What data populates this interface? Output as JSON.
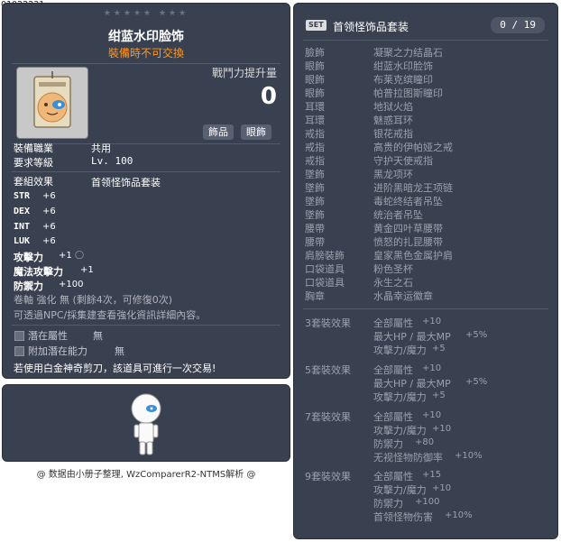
{
  "item_id": "01022231",
  "stars": "★★★★★ ★★★",
  "item": {
    "name": "绀蓝水印脸饰",
    "trade_note": "裝備時不可交換",
    "power_label": "戰鬥力提升量",
    "power_value": "0",
    "tags": [
      "飾品",
      "眼飾"
    ]
  },
  "requirements": {
    "job_label": "裝備職業",
    "job_value": "共用",
    "level_label": "要求等級",
    "level_value": "Lv. 100"
  },
  "set_effect": {
    "label": "套組效果",
    "value": "首领怪饰品套装"
  },
  "stats": [
    {
      "label": "STR",
      "value": "+6"
    },
    {
      "label": "DEX",
      "value": "+6"
    },
    {
      "label": "INT",
      "value": "+6"
    },
    {
      "label": "LUK",
      "value": "+6"
    },
    {
      "label": "攻擊力",
      "value": "+1"
    },
    {
      "label": "魔法攻擊力",
      "value": "+1"
    },
    {
      "label": "防禦力",
      "value": "+100"
    }
  ],
  "upgrade_text": "卷軸 強化 無 (剩餘4次，可修復0次)",
  "upgrade_text2": "可透過NPC/採集建查看強化資訊詳細內容。",
  "potential": {
    "label": "潛在屬性",
    "value": "無"
  },
  "bonus_potential": {
    "label": "附加潛在能力",
    "value": "無"
  },
  "scissors_note": "若使用白金神奇剪刀，該道具可進行一次交易!",
  "credit": "@ 数据由小册子整理, WzComparerR2-NTMS解析 @",
  "set_panel": {
    "badge": "SET",
    "title": "首领怪饰品套装",
    "count": "0 / 19",
    "items": [
      {
        "slot": "臉飾",
        "name": "凝聚之力结晶石"
      },
      {
        "slot": "眼飾",
        "name": "绀蓝水印脸饰"
      },
      {
        "slot": "眼飾",
        "name": "布莱克缤瞳印"
      },
      {
        "slot": "眼飾",
        "name": "帕普拉图斯瞳印"
      },
      {
        "slot": "耳環",
        "name": "地狱火焰"
      },
      {
        "slot": "耳環",
        "name": "魅惑耳环"
      },
      {
        "slot": "戒指",
        "name": "银花戒指"
      },
      {
        "slot": "戒指",
        "name": "高贵的伊帕娅之戒"
      },
      {
        "slot": "戒指",
        "name": "守护天使戒指"
      },
      {
        "slot": "墜飾",
        "name": "黑龙项环"
      },
      {
        "slot": "墜飾",
        "name": "进阶黑暗龙王项链"
      },
      {
        "slot": "墜飾",
        "name": "毒蛇终结者吊坠"
      },
      {
        "slot": "墜飾",
        "name": "统治者吊坠"
      },
      {
        "slot": "腰帶",
        "name": "黄金四叶草腰带"
      },
      {
        "slot": "腰帶",
        "name": "愤怒的扎昆腰带"
      },
      {
        "slot": "肩膀裝飾",
        "name": "皇家黑色金属护肩"
      },
      {
        "slot": "口袋道具",
        "name": "粉色圣杯"
      },
      {
        "slot": "口袋道具",
        "name": "永生之石"
      },
      {
        "slot": "胸章",
        "name": "水晶幸运徽章"
      }
    ],
    "effects": [
      {
        "level": "3套裝效果",
        "lines": [
          {
            "name": "全部屬性",
            "value": "+10"
          },
          {
            "name": "最大HP / 最大MP",
            "value": "+5%"
          },
          {
            "name": "攻擊力/魔力",
            "value": "+5"
          }
        ]
      },
      {
        "level": "5套裝效果",
        "lines": [
          {
            "name": "全部屬性",
            "value": "+10"
          },
          {
            "name": "最大HP / 最大MP",
            "value": "+5%"
          },
          {
            "name": "攻擊力/魔力",
            "value": "+5"
          }
        ]
      },
      {
        "level": "7套裝效果",
        "lines": [
          {
            "name": "全部屬性",
            "value": "+10"
          },
          {
            "name": "攻擊力/魔力",
            "value": "+10"
          },
          {
            "name": "防禦力",
            "value": "+80"
          },
          {
            "name": "无视怪物防御率",
            "value": "+10%"
          }
        ]
      },
      {
        "level": "9套裝效果",
        "lines": [
          {
            "name": "全部屬性",
            "value": "+15"
          },
          {
            "name": "攻擊力/魔力",
            "value": "+10"
          },
          {
            "name": "防禦力",
            "value": "+100"
          },
          {
            "name": "首领怪物伤害",
            "value": "+10%"
          }
        ]
      }
    ]
  }
}
